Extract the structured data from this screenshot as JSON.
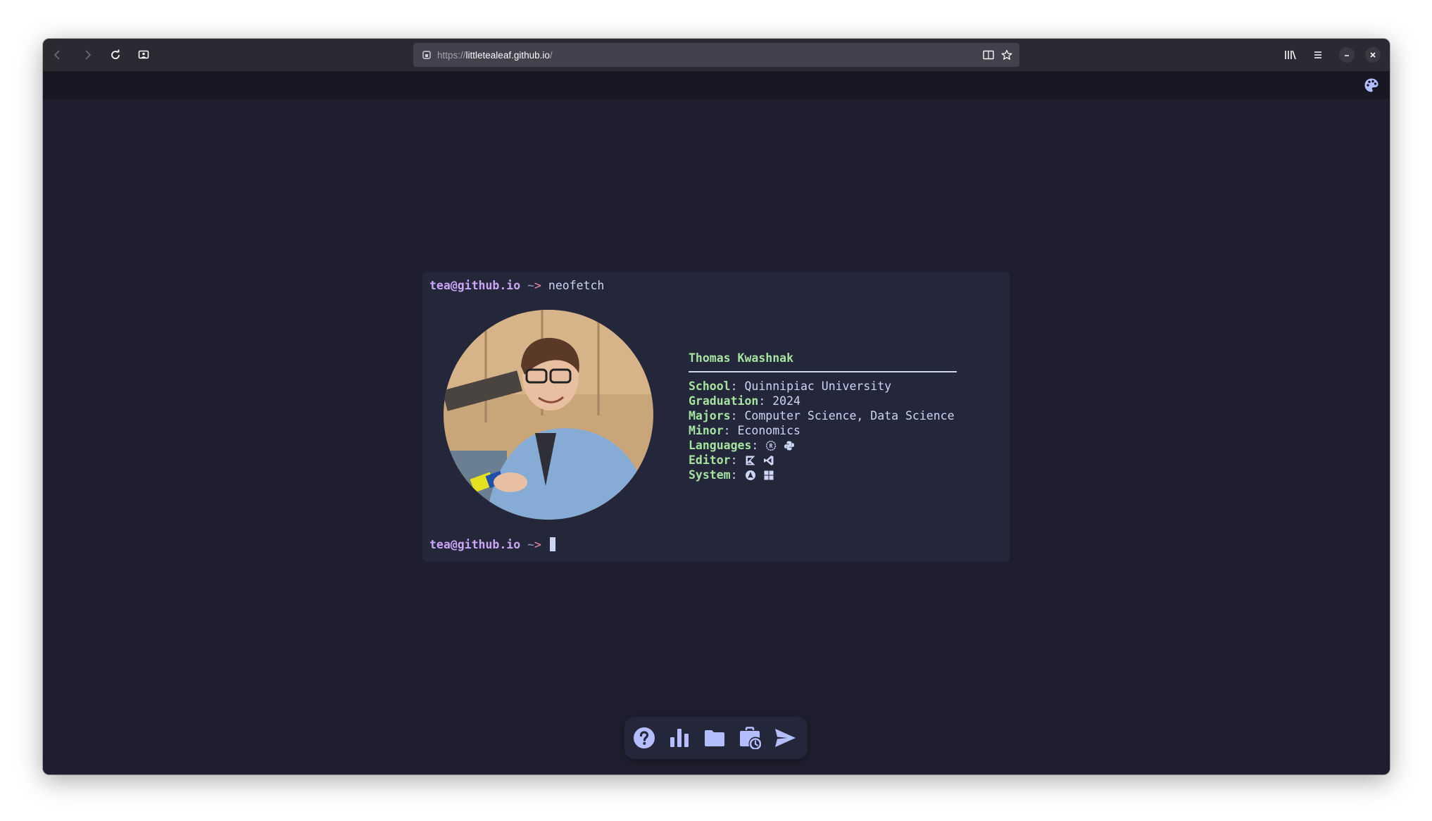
{
  "browser": {
    "url_scheme": "https://",
    "url_host": "littletealeaf.github.io",
    "url_path": "/"
  },
  "terminal": {
    "prompt_user": "tea@github.io",
    "prompt_tilde": "~",
    "prompt_arrow": ">",
    "command": "neofetch"
  },
  "profile": {
    "name": "Thomas Kwashnak",
    "fields": [
      {
        "key": "School",
        "value": "Quinnipiac University"
      },
      {
        "key": "Graduation",
        "value": "2024"
      },
      {
        "key": "Majors",
        "value": "Computer Science, Data Science"
      },
      {
        "key": "Minor",
        "value": "Economics"
      },
      {
        "key": "Languages",
        "icons": [
          "rust-icon",
          "python-icon"
        ]
      },
      {
        "key": "Editor",
        "icons": [
          "kotlin-intellij-icon",
          "vscode-icon"
        ]
      },
      {
        "key": "System",
        "icons": [
          "arch-linux-icon",
          "windows-icon"
        ]
      }
    ],
    "colon": ":"
  },
  "dock": {
    "items": [
      "help-icon",
      "stats-chart-icon",
      "folder-icon",
      "work-history-icon",
      "send-icon"
    ]
  },
  "colors": {
    "bg": "#1e1e2e",
    "terminal_bg": "#24273a",
    "accent_user": "#cba6f7",
    "accent_key": "#a6e3a1",
    "accent_arrow": "#f38ba8",
    "text": "#cdd6f4",
    "icon": "#b4befe"
  }
}
